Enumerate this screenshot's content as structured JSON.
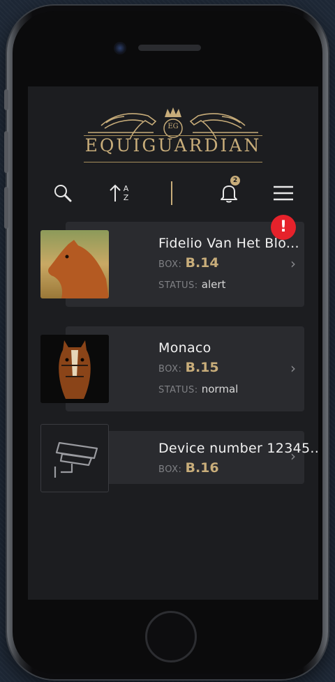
{
  "brand": {
    "monogram": "EG",
    "name": "EQUIGUARDIAN"
  },
  "toolbar": {
    "search_icon": "search-icon",
    "sort_icon": "sort-alpha-icon",
    "sort_a": "A",
    "sort_z": "Z",
    "bell_icon": "bell-icon",
    "notification_count": "2",
    "menu_icon": "hamburger-menu-icon"
  },
  "cards": [
    {
      "title": "Fidelio Van Het Blo...",
      "box_label": "BOX:",
      "box_value": "B.14",
      "status_label": "STATUS:",
      "status_value": "alert",
      "alert_icon": "!"
    },
    {
      "title": "Monaco",
      "box_label": "BOX:",
      "box_value": "B.15",
      "status_label": "STATUS:",
      "status_value": "normal"
    },
    {
      "title": "Device number 12345...",
      "box_label": "BOX:",
      "box_value": "B.16"
    }
  ],
  "chevron": "›",
  "colors": {
    "accent": "#c8ad7a",
    "alert": "#e6222b",
    "card": "#2a2b2f",
    "screen": "#1c1d20"
  }
}
